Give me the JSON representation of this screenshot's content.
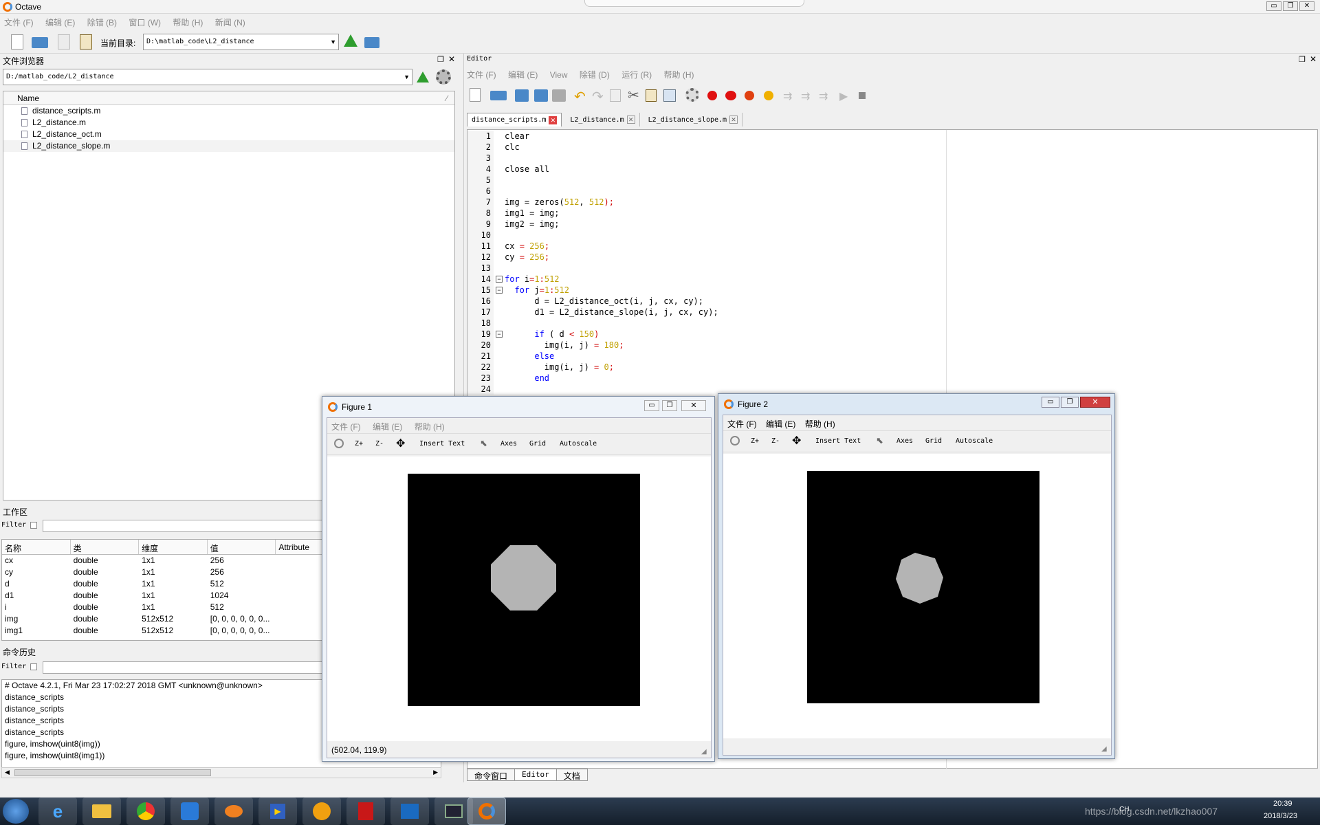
{
  "app": {
    "title": "Octave",
    "menu": [
      "文件 (F)",
      "编辑 (E)",
      "除错 (B)",
      "窗口 (W)",
      "帮助 (H)",
      "新闻 (N)"
    ]
  },
  "toolbar": {
    "current_dir_label": "当前目录:",
    "current_dir_value": "D:\\matlab_code\\L2_distance"
  },
  "file_browser": {
    "title": "文件浏览器",
    "path": "D:/matlab_code/L2_distance",
    "column_name": "Name",
    "files": [
      "distance_scripts.m",
      "L2_distance.m",
      "L2_distance_oct.m",
      "L2_distance_slope.m"
    ]
  },
  "workspace": {
    "title": "工作区",
    "filter_label": "Filter",
    "columns": [
      "名称",
      "类",
      "维度",
      "值",
      "Attribute"
    ],
    "rows": [
      [
        "cx",
        "double",
        "1x1",
        "256"
      ],
      [
        "cy",
        "double",
        "1x1",
        "256"
      ],
      [
        "d",
        "double",
        "1x1",
        "512"
      ],
      [
        "d1",
        "double",
        "1x1",
        "1024"
      ],
      [
        "i",
        "double",
        "1x1",
        "512"
      ],
      [
        "img",
        "double",
        "512x512",
        "[0, 0, 0, 0, 0, 0..."
      ],
      [
        "img1",
        "double",
        "512x512",
        "[0, 0, 0, 0, 0, 0..."
      ]
    ]
  },
  "history": {
    "title": "命令历史",
    "filter_label": "Filter",
    "items": [
      "# Octave 4.2.1, Fri Mar 23 17:02:27 2018 GMT <unknown@unknown>",
      "distance_scripts",
      "distance_scripts",
      "distance_scripts",
      "distance_scripts",
      "figure, imshow(uint8(img))",
      "figure, imshow(uint8(img1))"
    ]
  },
  "editor": {
    "title": "Editor",
    "menu": [
      "文件 (F)",
      "编辑 (E)",
      "View",
      "除错 (D)",
      "运行 (R)",
      "帮助 (H)"
    ],
    "tabs": [
      "distance_scripts.m",
      "L2_distance.m",
      "L2_distance_slope.m"
    ],
    "line_numbers": [
      "1",
      "2",
      "3",
      "4",
      "5",
      "6",
      "7",
      "8",
      "9",
      "10",
      "11",
      "12",
      "13",
      "14",
      "15",
      "16",
      "17",
      "18",
      "19",
      "20",
      "21",
      "22",
      "23",
      "24"
    ],
    "code": {
      "l1": "clear",
      "l2": "clc",
      "l4": "close all",
      "l7a": "img = zeros(",
      "l7b": "512",
      "l7c": ", ",
      "l7d": "512",
      "l7e": ");",
      "l8": "img1 = img;",
      "l9": "img2 = img;",
      "l11a": "cx ",
      "l11b": "=",
      "l11c": " 256",
      "l11d": ";",
      "l12a": "cy ",
      "l12b": "=",
      "l12c": " 256",
      "l12d": ";",
      "l14a": "for",
      "l14b": " i",
      "l14c": "=",
      "l14d": "1",
      "l14e": ":",
      "l14f": "512",
      "l15a": "for",
      "l15b": " j",
      "l15c": "=",
      "l15d": "1",
      "l15e": ":",
      "l15f": "512",
      "l16": "d = L2_distance_oct(i, j, cx, cy);",
      "l17": "d1 = L2_distance_slope(i, j, cx, cy);",
      "l19a": "if",
      "l19b": " ( d ",
      "l19c": "<",
      "l19d": " 150",
      "l19e": ")",
      "l20a": "img(i, j) ",
      "l20b": "=",
      "l20c": " 180",
      "l20d": ";",
      "l21": "else",
      "l22a": "img(i, j) ",
      "l22b": "=",
      "l22c": " 0",
      "l22d": ";",
      "l23": "end"
    },
    "bottom_tabs": [
      "命令窗口",
      "Editor",
      "文档"
    ]
  },
  "figure1": {
    "title": "Figure 1",
    "menu": [
      "文件 (F)",
      "编辑 (E)",
      "帮助 (H)"
    ],
    "tools": [
      "Z+",
      "Z-",
      "Insert Text",
      "Axes",
      "Grid",
      "Autoscale"
    ],
    "status": "(502.04, 119.9)"
  },
  "figure2": {
    "title": "Figure 2",
    "menu": [
      "文件 (F)",
      "编辑 (E)",
      "帮助 (H)"
    ],
    "tools": [
      "Z+",
      "Z-",
      "Insert Text",
      "Axes",
      "Grid",
      "Autoscale"
    ]
  },
  "taskbar": {
    "lang": "CH",
    "time": "20:39",
    "date": "2018/3/23",
    "watermark": "https://blog.csdn.net/lkzhao007"
  },
  "colors": {
    "accent": "#3c78d8",
    "editor_keyword": "#0000ff",
    "editor_number": "#c0a000",
    "editor_operator": "#d00000",
    "taskbar_bg": "#1c2a3a"
  }
}
